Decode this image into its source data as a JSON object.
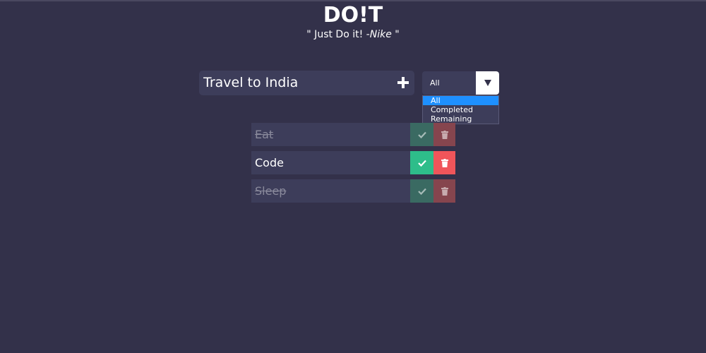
{
  "app": {
    "logo": "DO!T",
    "tagline_text": "\" Just Do it! ",
    "tagline_author": "-Nike",
    "tagline_close": " \""
  },
  "new_todo": {
    "value": "Travel to India",
    "add_icon": "plus-icon"
  },
  "filter": {
    "selected": "All",
    "arrow_icon": "triangle-down-icon",
    "options": [
      "All",
      "Completed",
      "Remaining"
    ],
    "highlighted_option": "All"
  },
  "todos": [
    {
      "text": "Eat",
      "completed": true
    },
    {
      "text": "Code",
      "completed": false
    },
    {
      "text": "Sleep",
      "completed": true
    }
  ],
  "colors": {
    "background": "#33314a",
    "panel": "#3d3d5a",
    "check": "#2ebd8a",
    "delete": "#f0555a",
    "dropdown_highlight": "#1e90ff"
  }
}
